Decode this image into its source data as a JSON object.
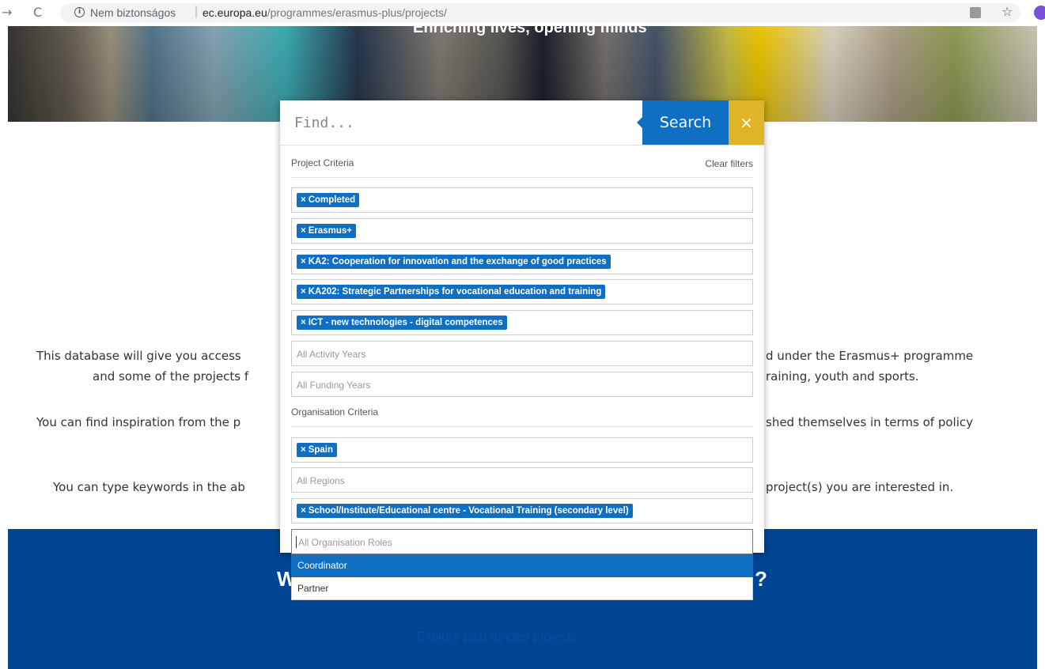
{
  "browser": {
    "back": "→",
    "reload": "C",
    "info": "i",
    "security_text": "Nem biztonságos",
    "separator": "|",
    "url_domain": "ec.europa.eu",
    "url_path": "/programmes/erasmus-plus/projects/",
    "star": "☆"
  },
  "hero": {
    "tagline": "Enriching lives, opening minds"
  },
  "intro": {
    "line1_left": "This database will give you access",
    "line1_right": "d under the Erasmus+ programme",
    "line2_left": "and some of the projects f",
    "line2_right": "raining, youth and sports.",
    "line3_left": "You can find inspiration from the p",
    "line3_right": "shed themselves in terms of policy",
    "line4_left": "You can type keywords in the ab",
    "line4_right": "project(s) you are interested in."
  },
  "blue_section": {
    "heading_left": "W",
    "heading_right": "?",
    "subtitle": "Explore past funded projects."
  },
  "search": {
    "placeholder": "Find...",
    "button_label": "Search",
    "close_label": "×"
  },
  "project_criteria": {
    "title": "Project Criteria",
    "clear_filters": "Clear filters",
    "status_tag": "Completed",
    "programme_tag": "Erasmus+",
    "action_tag": "KA2: Cooperation for innovation and the exchange of good practices",
    "action_type_tag": "KA202: Strategic Partnerships for vocational education and training",
    "topic_tag": "ICT - new technologies - digital competences",
    "activity_years_placeholder": "All Activity Years",
    "funding_years_placeholder": "All Funding Years"
  },
  "organisation_criteria": {
    "title": "Organisation Criteria",
    "country_tag": "Spain",
    "regions_placeholder": "All Regions",
    "org_type_tag": "School/Institute/Educational centre - Vocational Training (secondary level)",
    "roles_placeholder": "All Organisation Roles",
    "role_options": [
      "Coordinator",
      "Partner"
    ],
    "selected_role_option": "Coordinator"
  },
  "tag_remove_symbol": "×",
  "colors": {
    "search_blue": "#0e6fc3",
    "close_yellow": "#ddb526",
    "section_blue": "#004494"
  }
}
